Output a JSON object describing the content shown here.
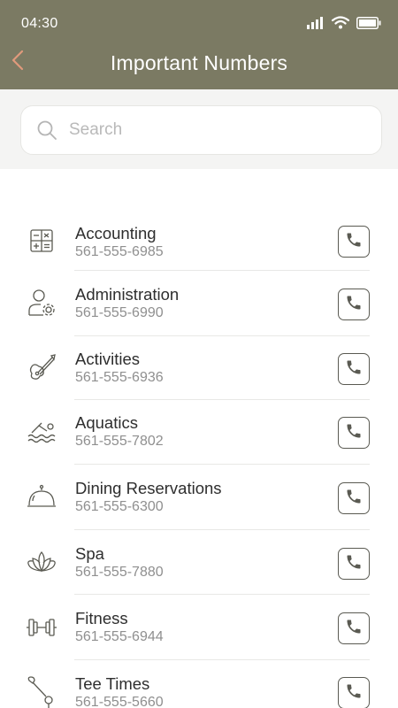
{
  "status_bar": {
    "time": "04:30"
  },
  "header": {
    "title": "Important Numbers"
  },
  "search": {
    "placeholder": "Search"
  },
  "contacts": [
    {
      "name": "Accounting",
      "phone": "561-555-6985",
      "icon": "calculator-icon"
    },
    {
      "name": "Administration",
      "phone": "561-555-6990",
      "icon": "user-gear-icon"
    },
    {
      "name": "Activities",
      "phone": "561-555-6936",
      "icon": "guitar-icon"
    },
    {
      "name": "Aquatics",
      "phone": "561-555-7802",
      "icon": "swimmer-icon"
    },
    {
      "name": "Dining Reservations",
      "phone": "561-555-6300",
      "icon": "cloche-icon"
    },
    {
      "name": "Spa",
      "phone": "561-555-7880",
      "icon": "lotus-icon"
    },
    {
      "name": "Fitness",
      "phone": "561-555-6944",
      "icon": "dumbbell-icon"
    },
    {
      "name": "Tee Times",
      "phone": "561-555-5660",
      "icon": "golf-club-icon"
    }
  ],
  "colors": {
    "header": "#7b7a63",
    "back_arrow": "#e09a7c",
    "icon_stroke": "#5a5a52"
  }
}
